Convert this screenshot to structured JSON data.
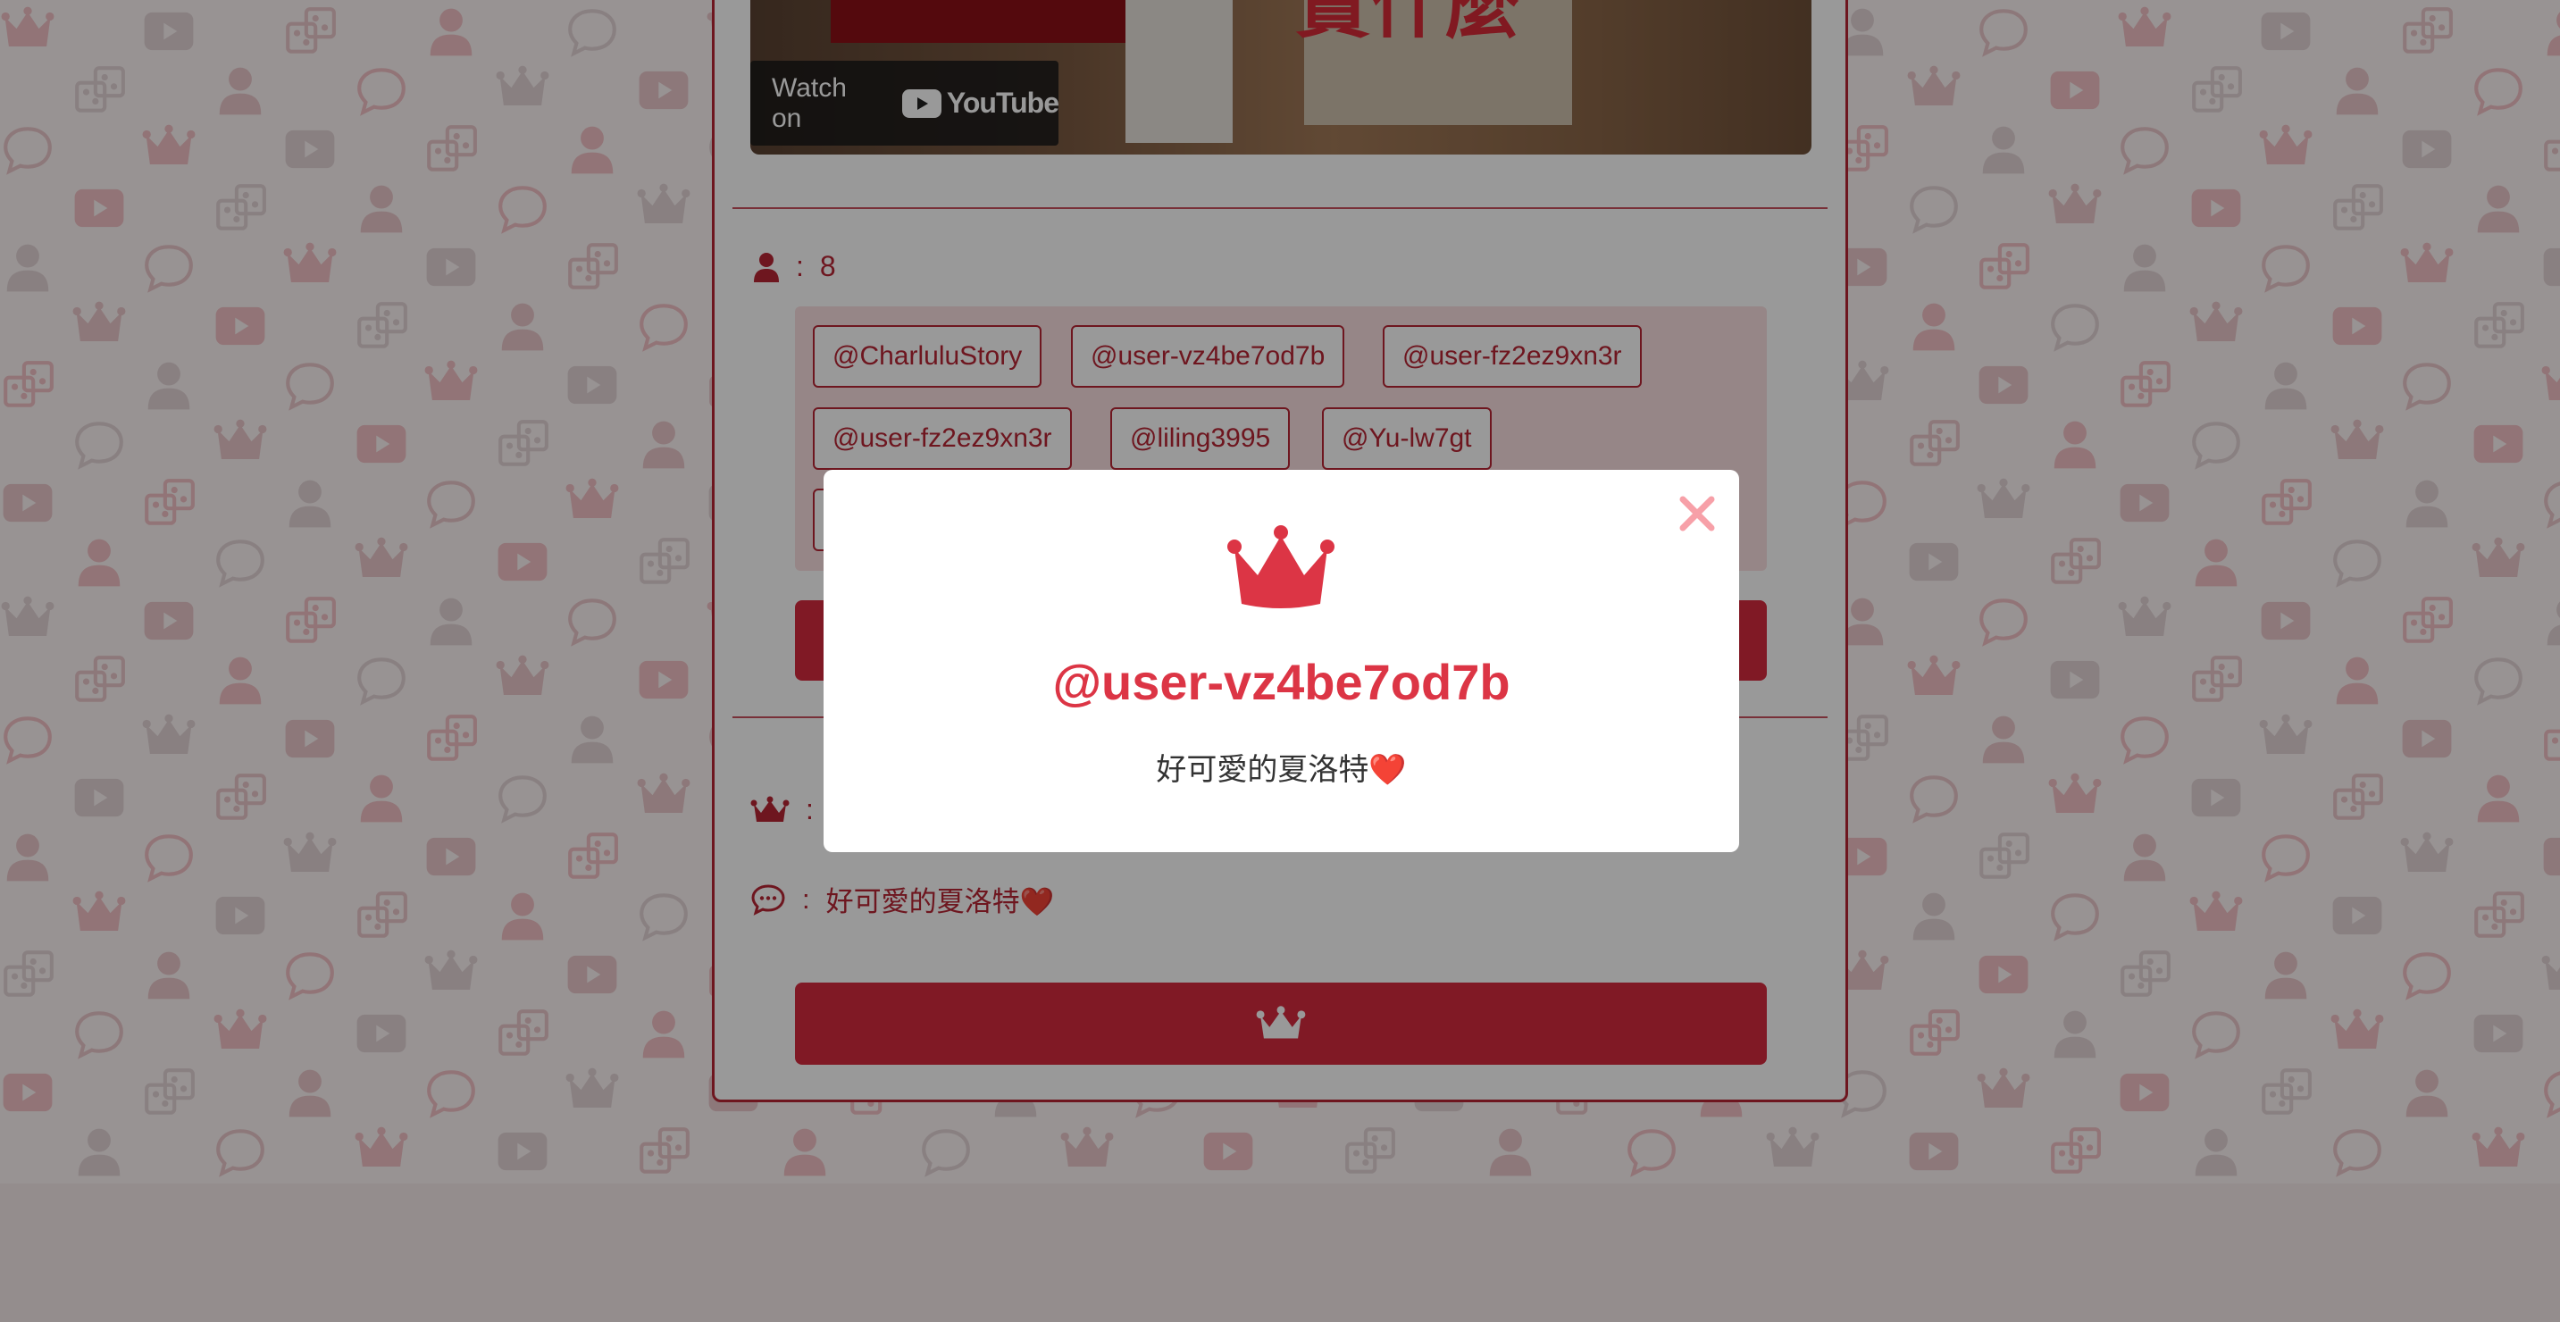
{
  "video": {
    "watch_on_label": "Watch on",
    "platform_name": "YouTube",
    "thumbnail_text": "賣什麼"
  },
  "participants": {
    "icon": "user-icon",
    "separator": ":",
    "count": "8",
    "tags": [
      "@CharluluStory",
      "@user-vz4be7od7b",
      "@user-fz2ez9xn3r",
      "@user-fz2ez9xn3r",
      "@liling3995",
      "@Yu-lw7gt"
    ]
  },
  "result": {
    "winner_icon": "crown-icon",
    "comment_icon": "comment-icon",
    "separator": ":",
    "comment": "好可愛的夏洛特❤️"
  },
  "draw_button": {
    "icon": "crown-icon"
  },
  "modal": {
    "icon": "crown-icon",
    "close_icon": "close-icon",
    "winner": "@user-vz4be7od7b",
    "comment": "好可愛的夏洛特❤️"
  },
  "colors": {
    "accent": "#dc3545",
    "dark_accent": "#b82535",
    "panel": "#fbe0e2",
    "close": "#f7a0a8"
  }
}
